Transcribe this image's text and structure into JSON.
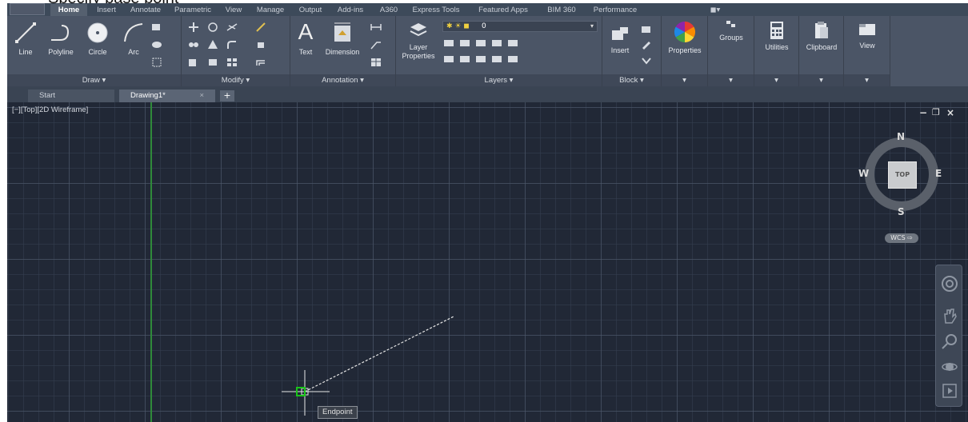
{
  "caption": {
    "text": "Specify base point"
  },
  "ribbon_tabs": [
    "Home",
    "Insert",
    "Annotate",
    "Parametric",
    "View",
    "Manage",
    "Output",
    "Add-ins",
    "A360",
    "Express Tools",
    "Featured Apps",
    "BIM 360",
    "Performance"
  ],
  "panels": {
    "draw": {
      "title": "Draw ▾",
      "tools": [
        "Line",
        "Polyline",
        "Circle",
        "Arc"
      ]
    },
    "modify": {
      "title": "Modify ▾"
    },
    "annotation": {
      "title": "Annotation ▾",
      "tools": [
        "Text",
        "Dimension"
      ]
    },
    "layers": {
      "title": "Layers ▾",
      "layer_properties": "Layer Properties",
      "layer_properties_l1": "Layer",
      "layer_properties_l2": "Properties",
      "current_layer": "0"
    },
    "block": {
      "title": "Block ▾",
      "insert": "Insert"
    },
    "properties": {
      "label": "Properties"
    },
    "groups": {
      "label": "Groups"
    },
    "utilities": {
      "label": "Utilities"
    },
    "clipboard": {
      "label": "Clipboard"
    },
    "view": {
      "label": "View"
    },
    "more_arrow": "▾"
  },
  "file_tabs": {
    "start": "Start",
    "drawing": "Drawing1*",
    "close": "×",
    "add": "+"
  },
  "viewport": {
    "label": "[−][Top][2D Wireframe]",
    "controls": {
      "minimize": "−",
      "restore": "❐",
      "close": "×"
    },
    "viewcube": {
      "north": "N",
      "south": "S",
      "east": "E",
      "west": "W",
      "face": "TOP",
      "wcs": "WCS ⇨"
    },
    "snap_tooltip": "Endpoint"
  },
  "colors": {
    "ribbon": "#4b5566",
    "canvas": "#212836",
    "y_axis": "#2f8a3a",
    "snap_marker": "#19c419"
  }
}
